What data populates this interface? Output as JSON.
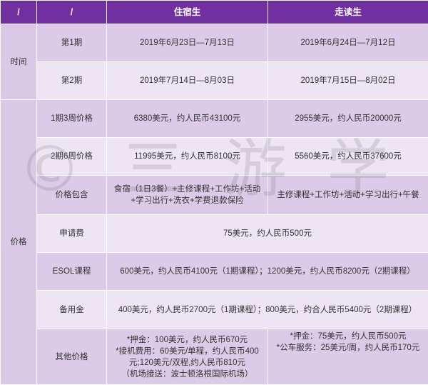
{
  "header": {
    "col1": "/",
    "col2": "/",
    "col3": "住宿生",
    "col4": "走读生"
  },
  "time": {
    "group_label": "时间",
    "rows": [
      {
        "label": "第1期",
        "boarding": "2019年6月23日—7月13日",
        "day": "2019年6月24日—7月12日"
      },
      {
        "label": "第2期",
        "boarding": "2019年7月14日—8月03日",
        "day": "2019年7月15日—8月02日"
      }
    ]
  },
  "price": {
    "group_label": "价格",
    "row1": {
      "label": "1期3周价格",
      "boarding": "6380美元，约人民币43100元",
      "day": "2955美元，约人民币20000元"
    },
    "row2": {
      "label": "2期6周价格",
      "boarding": "11995美元，约人民币8100元",
      "day": "5560美元，约人民币37600元"
    },
    "row3": {
      "label": "价格包含",
      "boarding_line1": "食宿（1日3餐）+主修课程+工作坊+活动",
      "boarding_line2": "+学习出行+洗衣+学费退款保险",
      "day": "主修课程+工作坊+活动+学习出行+午餐"
    },
    "row4": {
      "label": "申请费",
      "value": "75美元，约人民币500元"
    },
    "row5": {
      "label": "ESOL课程",
      "value": "600美元，约人民币4100元（1期课程）；1200美元，约人民币8200元（2期课程）"
    },
    "row6": {
      "label": "备用金",
      "value": "400美元，约人民币2700元（1期课程）；800美元，约合人民币5400元（2期课程）"
    },
    "row7": {
      "label": "其他价格",
      "boarding_lines": [
        "*押金：100美元，约人民币670元",
        "*接机费用：60美元/单程，约人民币400",
        "元;120美元/双程,约人民币810元",
        "（机场接送：波士顿洛根国际机场）"
      ],
      "day_lines": [
        "*押金：75美元，约人民币500元",
        "*公车服务：25美元/周，约人民币170元"
      ]
    }
  },
  "watermark": "© 三 游 学"
}
